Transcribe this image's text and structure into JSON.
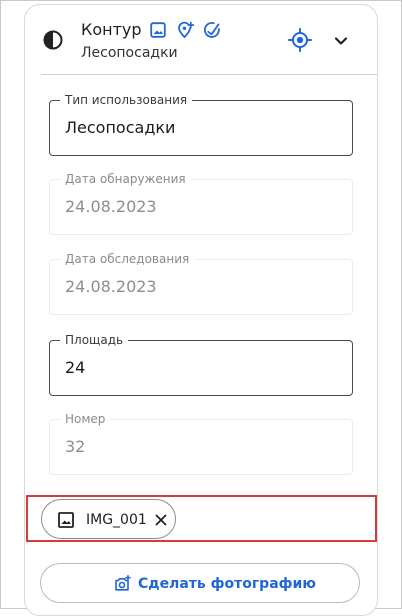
{
  "colors": {
    "accent": "#2166d9",
    "selection_outline": "#d83a3a",
    "text_primary": "#1f1f1f",
    "text_disabled": "#8d8d8d"
  },
  "header": {
    "title": "Контур",
    "subtitle": "Лесопосадки",
    "icons": [
      "contrast-icon",
      "image-icon",
      "location-add-icon",
      "edit-check-icon",
      "target-icon",
      "chevron-down-icon"
    ]
  },
  "fields": [
    {
      "label": "Тип использования",
      "value": "Лесопосадки",
      "state": "active"
    },
    {
      "label": "Дата обнаружения",
      "value": "24.08.2023",
      "state": "disabled"
    },
    {
      "label": "Дата обследования",
      "value": "24.08.2023",
      "state": "disabled"
    },
    {
      "label": "Площадь",
      "value": "24",
      "state": "active"
    },
    {
      "label": "Номер",
      "value": "32",
      "state": "disabled"
    }
  ],
  "attachment": {
    "chip_label": "IMG_001",
    "icons": [
      "image-icon",
      "close-icon"
    ]
  },
  "actions": {
    "take_photo_label": "Сделать фотографию",
    "take_photo_icon": "camera-add-icon"
  }
}
